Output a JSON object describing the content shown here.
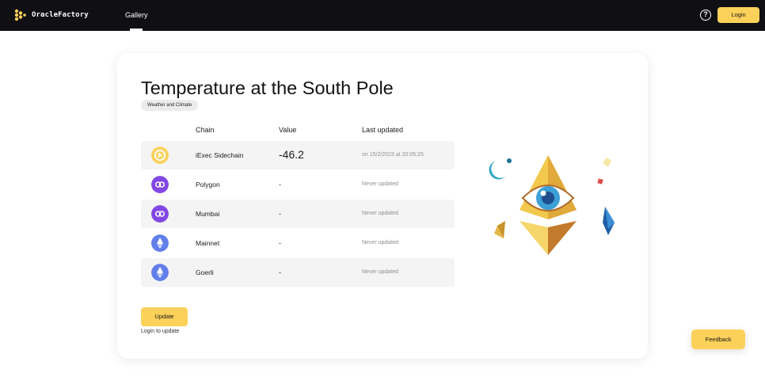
{
  "header": {
    "brand_name": "OracleFactory",
    "nav_gallery": "Gallery",
    "help_symbol": "?",
    "login_label": "Login"
  },
  "oracle": {
    "title": "Temperature at the South Pole",
    "category": "Weather and Climate"
  },
  "table": {
    "headers": {
      "chain": "Chain",
      "value": "Value",
      "last_updated": "Last updated"
    },
    "rows": [
      {
        "chain": "iExec Sidechain",
        "value": "-46.2",
        "last_updated": "on 15/2/2023 at 20:05:25",
        "icon": "iexec-sidechain-icon"
      },
      {
        "chain": "Polygon",
        "value": "-",
        "last_updated": "Never updated",
        "icon": "polygon-icon"
      },
      {
        "chain": "Mumbai",
        "value": "-",
        "last_updated": "Never updated",
        "icon": "polygon-icon"
      },
      {
        "chain": "Mainnet",
        "value": "-",
        "last_updated": "Never updated",
        "icon": "ethereum-icon"
      },
      {
        "chain": "Goerli",
        "value": "-",
        "last_updated": "Never updated",
        "icon": "ethereum-icon"
      }
    ]
  },
  "actions": {
    "update_label": "Update",
    "login_hint": "Login to update",
    "feedback_label": "Feedback"
  },
  "colors": {
    "accent": "#fcd15a",
    "topbar": "#0f0f14",
    "row_shade": "#f4f4f5",
    "polygon": "#8247e5",
    "ethereum": "#627eea"
  }
}
